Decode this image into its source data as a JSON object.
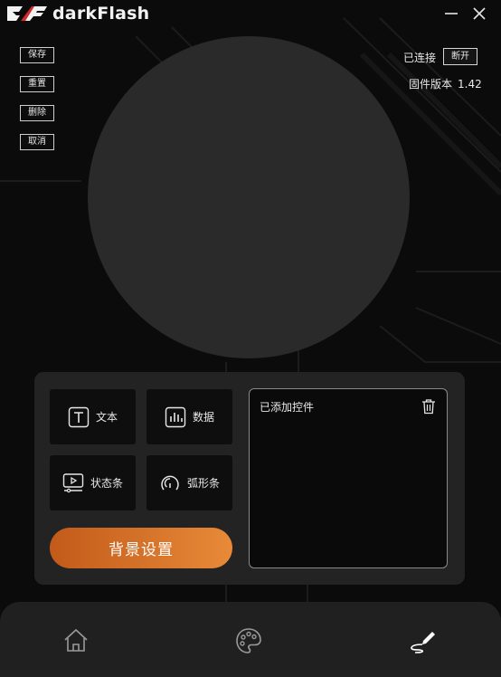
{
  "app": {
    "brand": "darkFlash"
  },
  "toolbar": {
    "save": "保存",
    "reset": "重置",
    "delete": "删除",
    "cancel": "取消"
  },
  "connection": {
    "status": "已连接",
    "disconnect": "断开",
    "firmware_label": "固件版本",
    "firmware_version": "1.42"
  },
  "widgets": {
    "text": "文本",
    "data": "数据",
    "status_bar": "状态条",
    "arc_bar": "弧形条"
  },
  "background_settings": "背景设置",
  "added_panel": {
    "title": "已添加控件"
  },
  "colors": {
    "accent_start": "#c25a1a",
    "accent_end": "#e88a38",
    "logo_red": "#d22a2a",
    "preview": "#2a2a2a"
  },
  "nav": {
    "items": [
      {
        "icon": "home-icon"
      },
      {
        "icon": "palette-icon"
      },
      {
        "icon": "pen-edit-icon",
        "active": true
      }
    ]
  }
}
